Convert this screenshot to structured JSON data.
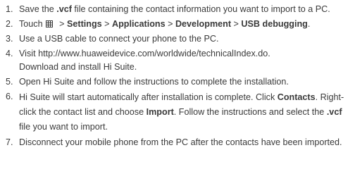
{
  "steps": [
    {
      "number": "1.",
      "parts": [
        "Save the ",
        ".vcf",
        " file containing the contact information you want to import to a PC."
      ]
    },
    {
      "number": "2.",
      "touch": "Touch",
      "icon": "menu-grid-icon",
      "sep1": " > ",
      "settings": "Settings",
      "sep2": " > ",
      "applications": "Applications",
      "sep3": " > ",
      "development": "Development",
      "sep4": " > ",
      "usb_debugging": "USB debugging",
      "end": "."
    },
    {
      "number": "3.",
      "text": "Use a USB cable to connect your phone to the PC."
    },
    {
      "number": "4.",
      "line1": "Visit http://www.huaweidevice.com/worldwide/technicalIndex.do.",
      "line2": "Download and install Hi Suite."
    },
    {
      "number": "5.",
      "text": "Open Hi Suite and follow the instructions to complete the installation."
    },
    {
      "number": "6.",
      "parts": [
        "Hi Suite will start automatically after installation is complete. Click ",
        "Contacts",
        ". Right-click the contact list and choose ",
        "Import",
        ". Follow the instructions and select the ",
        ".vcf",
        " file you want to import."
      ]
    },
    {
      "number": "7.",
      "text": "Disconnect your mobile phone from the PC after the contacts have been imported."
    }
  ]
}
